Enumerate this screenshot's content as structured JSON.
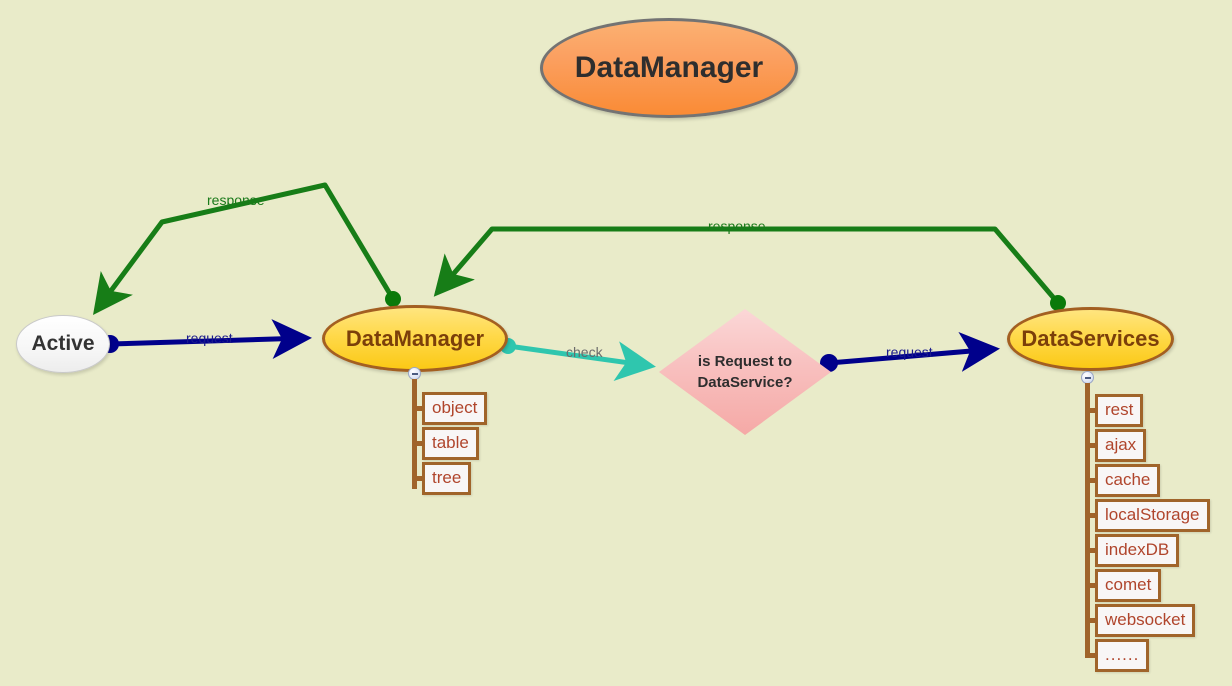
{
  "diagram": {
    "title": "DataManager",
    "background_color": "#e9ebc9",
    "nodes": {
      "title_node": {
        "label": "DataManager",
        "shape": "ellipse",
        "fill": "#fa8b35",
        "border": "#737373"
      },
      "active": {
        "label": "Active",
        "shape": "ellipse",
        "fill": "#ffffff",
        "border": "#c9c9c9"
      },
      "data_manager": {
        "label": "DataManager",
        "shape": "ellipse",
        "fill": "#ffd94a",
        "border": "#a35f21"
      },
      "decision": {
        "label_line1": "is Request to",
        "label_line2": "DataService?",
        "shape": "diamond",
        "fill": "#f8c0bf"
      },
      "data_services": {
        "label": "DataServices",
        "shape": "ellipse",
        "fill": "#ffd94a",
        "border": "#a35f21"
      }
    },
    "trees": {
      "data_manager_children": {
        "toggle": "collapse-minus-icon",
        "items": [
          {
            "label": "object"
          },
          {
            "label": "table"
          },
          {
            "label": "tree"
          }
        ]
      },
      "data_services_children": {
        "toggle": "collapse-minus-icon",
        "items": [
          {
            "label": "rest"
          },
          {
            "label": "ajax"
          },
          {
            "label": "cache"
          },
          {
            "label": "localStorage"
          },
          {
            "label": "indexDB"
          },
          {
            "label": "comet"
          },
          {
            "label": "websocket"
          },
          {
            "label": "......"
          }
        ]
      }
    },
    "edges": [
      {
        "id": "resp_left",
        "label": "response",
        "color": "#1a7a1a",
        "from": "data_manager",
        "to": "active"
      },
      {
        "id": "req_left",
        "label": "request",
        "color": "#00008b",
        "from": "active",
        "to": "data_manager"
      },
      {
        "id": "check",
        "label": "check",
        "color": "#2fc6ae",
        "from": "data_manager",
        "to": "decision"
      },
      {
        "id": "req_right",
        "label": "request",
        "color": "#00008b",
        "from": "decision",
        "to": "data_services"
      },
      {
        "id": "resp_right",
        "label": "response",
        "color": "#1a7a1a",
        "from": "data_services",
        "to": "data_manager"
      }
    ]
  }
}
